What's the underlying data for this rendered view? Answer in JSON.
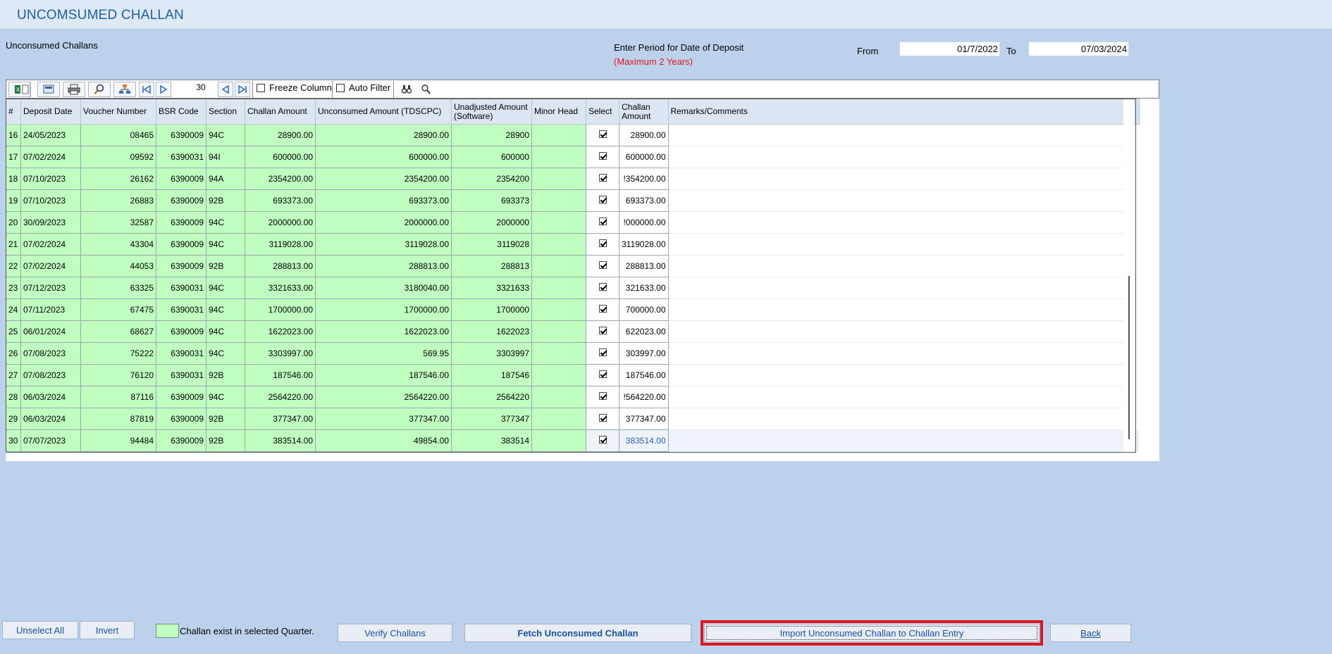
{
  "window": {
    "title": "UNCOMSUMED CHALLAN"
  },
  "section_label": "Unconsumed Challans",
  "period": {
    "label": "Enter Period for Date of Deposit",
    "note": "(Maximum 2 Years)",
    "from_label": "From",
    "from_value": "01/7/2022",
    "to_label": "To",
    "to_value": "07/03/2024"
  },
  "toolbar": {
    "icons": [
      "excel-export-icon",
      "copy-icon",
      "csv-export-icon",
      "print-icon",
      "find-icon",
      "hierarchy-icon",
      "first-page-icon",
      "next-page-icon",
      "prev-icon",
      "last-icon",
      "binoculars-icon",
      "search-advanced-icon"
    ],
    "page_count": "30",
    "freeze_column_label": "Freeze Column",
    "auto_filter_label": "Auto Filter"
  },
  "table": {
    "columns": [
      "#",
      "Deposit Date",
      "Voucher Number",
      "BSR Code",
      "Section",
      "Challan Amount",
      "Unconsumed Amount (TDSCPC)",
      "Unadjusted Amount (Software)",
      "Minor Head",
      "Select",
      "Challan Amount",
      "Remarks/Comments"
    ],
    "rows": [
      {
        "num": "16",
        "date": "24/05/2023",
        "voucher": "08465",
        "bsr": "6390009",
        "section": "94C",
        "challan": "28900.00",
        "unconsumed": "28900.00",
        "unadjusted": "28900",
        "minor": "",
        "selected": true,
        "amount": "28900.00",
        "remarks": ""
      },
      {
        "num": "17",
        "date": "07/02/2024",
        "voucher": "09592",
        "bsr": "6390031",
        "section": "94I",
        "challan": "600000.00",
        "unconsumed": "600000.00",
        "unadjusted": "600000",
        "minor": "",
        "selected": true,
        "amount": "600000.00",
        "remarks": ""
      },
      {
        "num": "18",
        "date": "07/10/2023",
        "voucher": "26162",
        "bsr": "6390009",
        "section": "94A",
        "challan": "2354200.00",
        "unconsumed": "2354200.00",
        "unadjusted": "2354200",
        "minor": "",
        "selected": true,
        "amount": "!354200.00",
        "remarks": ""
      },
      {
        "num": "19",
        "date": "07/10/2023",
        "voucher": "26883",
        "bsr": "6390009",
        "section": "92B",
        "challan": "693373.00",
        "unconsumed": "693373.00",
        "unadjusted": "693373",
        "minor": "",
        "selected": true,
        "amount": "693373.00",
        "remarks": ""
      },
      {
        "num": "20",
        "date": "30/09/2023",
        "voucher": "32587",
        "bsr": "6390009",
        "section": "94C",
        "challan": "2000000.00",
        "unconsumed": "2000000.00",
        "unadjusted": "2000000",
        "minor": "",
        "selected": true,
        "amount": "!000000.00",
        "remarks": ""
      },
      {
        "num": "21",
        "date": "07/02/2024",
        "voucher": "43304",
        "bsr": "6390009",
        "section": "94C",
        "challan": "3119028.00",
        "unconsumed": "3119028.00",
        "unadjusted": "3119028",
        "minor": "",
        "selected": true,
        "amount": "3119028.00",
        "remarks": ""
      },
      {
        "num": "22",
        "date": "07/02/2024",
        "voucher": "44053",
        "bsr": "6390009",
        "section": "92B",
        "challan": "288813.00",
        "unconsumed": "288813.00",
        "unadjusted": "288813",
        "minor": "",
        "selected": true,
        "amount": "288813.00",
        "remarks": ""
      },
      {
        "num": "23",
        "date": "07/12/2023",
        "voucher": "63325",
        "bsr": "6390031",
        "section": "94C",
        "challan": "3321633.00",
        "unconsumed": "3180040.00",
        "unadjusted": "3321633",
        "minor": "",
        "selected": true,
        "amount": "321633.00",
        "remarks": ""
      },
      {
        "num": "24",
        "date": "07/11/2023",
        "voucher": "67475",
        "bsr": "6390031",
        "section": "94C",
        "challan": "1700000.00",
        "unconsumed": "1700000.00",
        "unadjusted": "1700000",
        "minor": "",
        "selected": true,
        "amount": "700000.00",
        "remarks": ""
      },
      {
        "num": "25",
        "date": "06/01/2024",
        "voucher": "68627",
        "bsr": "6390009",
        "section": "94C",
        "challan": "1622023.00",
        "unconsumed": "1622023.00",
        "unadjusted": "1622023",
        "minor": "",
        "selected": true,
        "amount": "622023.00",
        "remarks": ""
      },
      {
        "num": "26",
        "date": "07/08/2023",
        "voucher": "75222",
        "bsr": "6390031",
        "section": "94C",
        "challan": "3303997.00",
        "unconsumed": "569.95",
        "unadjusted": "3303997",
        "minor": "",
        "selected": true,
        "amount": "303997.00",
        "remarks": ""
      },
      {
        "num": "27",
        "date": "07/08/2023",
        "voucher": "76120",
        "bsr": "6390031",
        "section": "92B",
        "challan": "187546.00",
        "unconsumed": "187546.00",
        "unadjusted": "187546",
        "minor": "",
        "selected": true,
        "amount": "187546.00",
        "remarks": ""
      },
      {
        "num": "28",
        "date": "06/03/2024",
        "voucher": "87116",
        "bsr": "6390009",
        "section": "94C",
        "challan": "2564220.00",
        "unconsumed": "2564220.00",
        "unadjusted": "2564220",
        "minor": "",
        "selected": true,
        "amount": "!564220.00",
        "remarks": ""
      },
      {
        "num": "29",
        "date": "06/03/2024",
        "voucher": "87819",
        "bsr": "6390009",
        "section": "92B",
        "challan": "377347.00",
        "unconsumed": "377347.00",
        "unadjusted": "377347",
        "minor": "",
        "selected": true,
        "amount": "377347.00",
        "remarks": ""
      },
      {
        "num": "30",
        "date": "07/07/2023",
        "voucher": "94484",
        "bsr": "6390009",
        "section": "92B",
        "challan": "383514.00",
        "unconsumed": "49854.00",
        "unadjusted": "383514",
        "minor": "",
        "selected": true,
        "amount": "383514.00",
        "remarks": ""
      }
    ]
  },
  "footer": {
    "unselect_all": "Unselect All",
    "invert": "Invert",
    "legend_text": "Challan exist in selected Quarter.",
    "verify": "Verify Challans",
    "fetch": "Fetch Unconsumed Challan",
    "import": "Import Unconsumed Challan to Challan Entry",
    "back": "Back"
  },
  "colors": {
    "background": "#bcd2ec",
    "title": "#1a5fa8",
    "existing_challan_row": "#c0ffc0",
    "highlight": "#e0141e",
    "note": "#e0141e"
  }
}
